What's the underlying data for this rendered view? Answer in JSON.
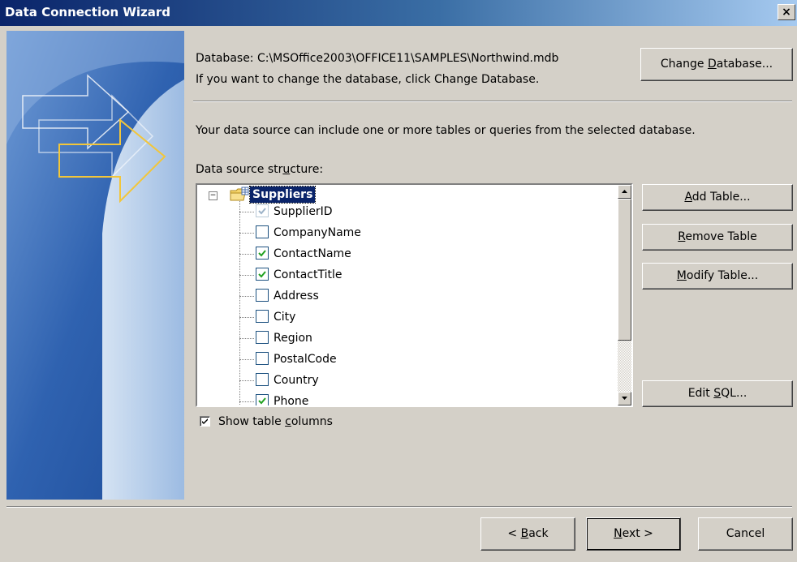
{
  "window": {
    "title": "Data Connection Wizard",
    "close_label": "×"
  },
  "database": {
    "path_text": "Database: C:\\MSOffice2003\\OFFICE11\\SAMPLES\\Northwind.mdb",
    "hint_text": "If you want to change the database, click Change Database.",
    "change_button": {
      "pre": "Change ",
      "key": "D",
      "post": "atabase..."
    }
  },
  "info_text": "Your data source can include one or more tables or queries from the selected database.",
  "structure": {
    "label": {
      "pre": "Data source str",
      "key": "u",
      "post": "cture:"
    },
    "root": {
      "label": "Suppliers",
      "expander": "−"
    },
    "columns": [
      {
        "name": "SupplierID",
        "checked": true,
        "disabled": true
      },
      {
        "name": "CompanyName",
        "checked": false,
        "disabled": false
      },
      {
        "name": "ContactName",
        "checked": true,
        "disabled": false
      },
      {
        "name": "ContactTitle",
        "checked": true,
        "disabled": false
      },
      {
        "name": "Address",
        "checked": false,
        "disabled": false
      },
      {
        "name": "City",
        "checked": false,
        "disabled": false
      },
      {
        "name": "Region",
        "checked": false,
        "disabled": false
      },
      {
        "name": "PostalCode",
        "checked": false,
        "disabled": false
      },
      {
        "name": "Country",
        "checked": false,
        "disabled": false
      },
      {
        "name": "Phone",
        "checked": true,
        "disabled": false
      }
    ]
  },
  "side_buttons": {
    "add_table": {
      "pre": "",
      "key": "A",
      "post": "dd Table..."
    },
    "remove_table": {
      "pre": "",
      "key": "R",
      "post": "emove Table"
    },
    "modify_table": {
      "pre": "",
      "key": "M",
      "post": "odify Table..."
    },
    "edit_sql": {
      "pre": "Edit ",
      "key": "S",
      "post": "QL..."
    }
  },
  "show_columns": {
    "checked": true,
    "pre": "Show table ",
    "key": "c",
    "post": "olumns"
  },
  "nav": {
    "back": {
      "pre": "< ",
      "key": "B",
      "post": "ack"
    },
    "next": {
      "pre": "",
      "key": "N",
      "post": "ext >"
    },
    "cancel": "Cancel"
  },
  "colors": {
    "title_start": "#0a246a",
    "title_end": "#a6caf0",
    "check_green": "#21a121",
    "face": "#d4d0c8"
  }
}
